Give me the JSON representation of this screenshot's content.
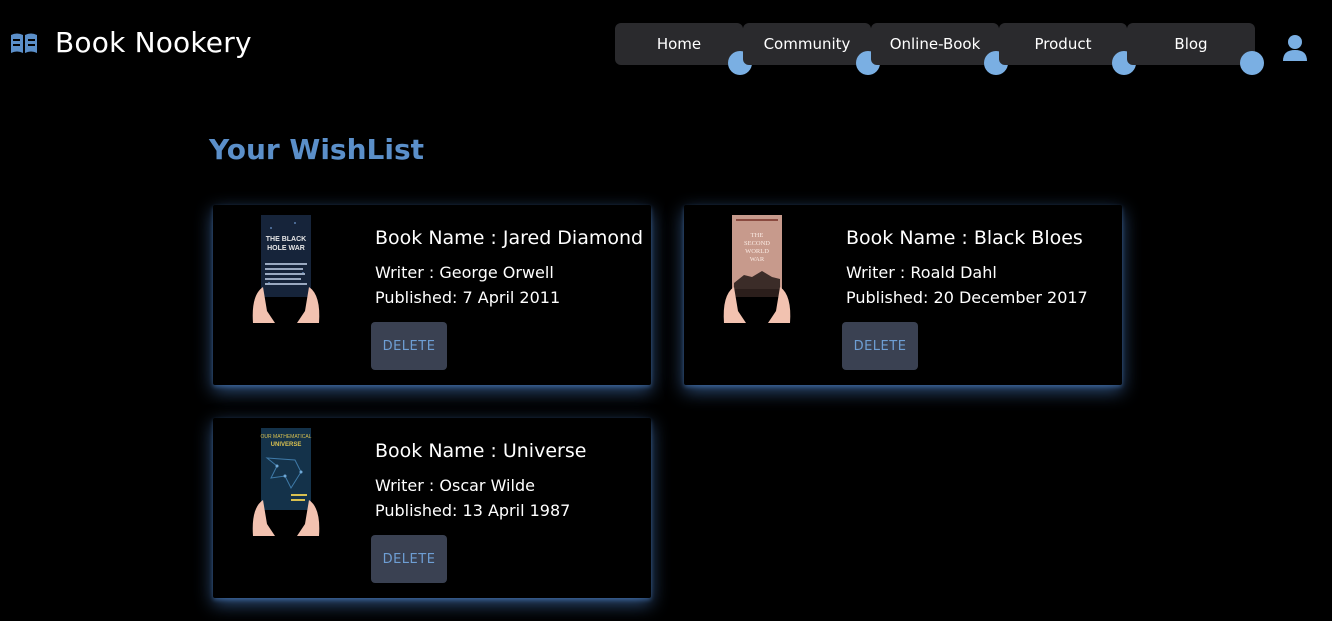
{
  "header": {
    "brand_title": "Book Nookery",
    "brand_icon": "book-open-icon",
    "user_icon": "user-icon"
  },
  "nav": {
    "items": [
      {
        "label": "Home"
      },
      {
        "label": "Community"
      },
      {
        "label": "Online-Book"
      },
      {
        "label": "Product"
      },
      {
        "label": "Blog"
      }
    ]
  },
  "wishlist": {
    "title": "Your WishList",
    "delete_label": "DELETE",
    "books": [
      {
        "name": "Book Name : Jared Diamond",
        "writer": "Writer : George Orwell",
        "published": "Published: 7 April 2011",
        "cover_lines": [
          "THE BLACK",
          "HOLE WAR"
        ]
      },
      {
        "name": "Book Name : Black Bloes",
        "writer": "Writer : Roald Dahl",
        "published": "Published: 20 December 2017",
        "cover_lines": [
          "THE",
          "SECOND",
          "WORLD",
          "WAR"
        ]
      },
      {
        "name": "Book Name : Universe",
        "writer": "Writer : Oscar Wilde",
        "published": "Published: 13 April 1987",
        "cover_lines": [
          "OUR MATHEMATICAL",
          "UNIVERSE"
        ]
      }
    ]
  },
  "colors": {
    "accent": "#5b8fc9",
    "nav_dot": "#7aafe3",
    "nav_bg": "#2a2a2d",
    "delete_bg": "#3a4152"
  }
}
